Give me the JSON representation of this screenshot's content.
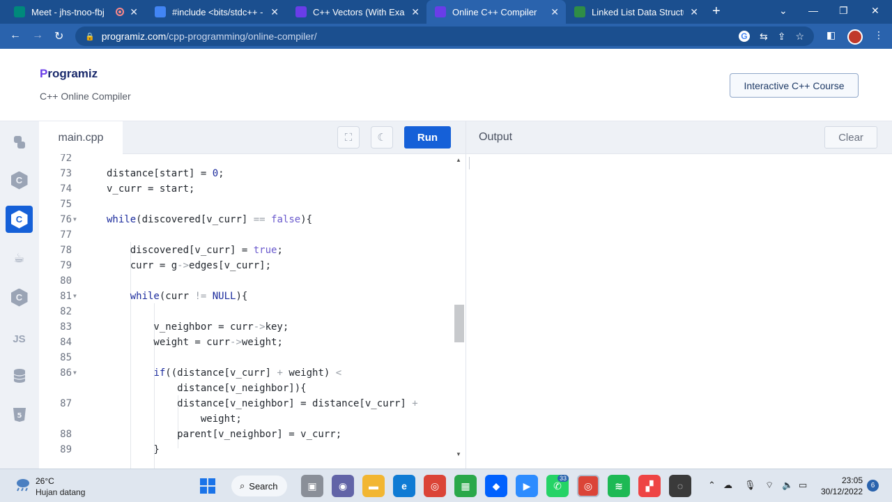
{
  "browser": {
    "tabs": [
      {
        "title": "Meet - jhs-tnoo-fbj",
        "favicon": "google-meet-icon",
        "color": "#00897b"
      },
      {
        "title": "#include <bits/stdc++ - G",
        "favicon": "google-docs-icon",
        "color": "#4285f4"
      },
      {
        "title": "C++ Vectors (With Examp",
        "favicon": "programiz-icon",
        "color": "#6a3de8"
      },
      {
        "title": "Online C++ Compiler",
        "favicon": "programiz-icon",
        "color": "#6a3de8"
      },
      {
        "title": "Linked List Data Structure",
        "favicon": "geeksforgeeks-icon",
        "color": "#2f8d46"
      }
    ],
    "new_tab": "+",
    "url_host": "programiz.com",
    "url_path": "/cpp-programming/online-compiler/"
  },
  "header": {
    "logo_p": "P",
    "logo_rest": "rogramiz",
    "subtitle": "C++ Online Compiler",
    "course_button": "Interactive C++ Course"
  },
  "rail": [
    {
      "name": "python",
      "label": ""
    },
    {
      "name": "c",
      "label": "C"
    },
    {
      "name": "cpp",
      "label": "C"
    },
    {
      "name": "java",
      "label": ""
    },
    {
      "name": "csharp",
      "label": "C"
    },
    {
      "name": "javascript",
      "label": "JS"
    },
    {
      "name": "sql",
      "label": ""
    },
    {
      "name": "html",
      "label": "5"
    }
  ],
  "editor": {
    "file_name": "main.cpp",
    "run_label": "Run",
    "lines": [
      {
        "n": "72",
        "fold": false,
        "code": ""
      },
      {
        "n": "73",
        "fold": false,
        "code": "distance[start] = 0;"
      },
      {
        "n": "74",
        "fold": false,
        "code": "v_curr = start;"
      },
      {
        "n": "75",
        "fold": false,
        "code": ""
      },
      {
        "n": "76",
        "fold": true,
        "code": "while(discovered[v_curr] == false){"
      },
      {
        "n": "77",
        "fold": false,
        "code": ""
      },
      {
        "n": "78",
        "fold": false,
        "code": "    discovered[v_curr] = true;"
      },
      {
        "n": "79",
        "fold": false,
        "code": "    curr = g->edges[v_curr];"
      },
      {
        "n": "80",
        "fold": false,
        "code": ""
      },
      {
        "n": "81",
        "fold": true,
        "code": "    while(curr != NULL){"
      },
      {
        "n": "82",
        "fold": false,
        "code": ""
      },
      {
        "n": "83",
        "fold": false,
        "code": "        v_neighbor = curr->key;"
      },
      {
        "n": "84",
        "fold": false,
        "code": "        weight = curr->weight;"
      },
      {
        "n": "85",
        "fold": false,
        "code": ""
      },
      {
        "n": "86",
        "fold": true,
        "code": "        if((distance[v_curr] + weight) <"
      },
      {
        "n": "",
        "fold": false,
        "code": "            distance[v_neighbor]){"
      },
      {
        "n": "87",
        "fold": false,
        "code": "            distance[v_neighbor] = distance[v_curr] +"
      },
      {
        "n": "",
        "fold": false,
        "code": "                weight;"
      },
      {
        "n": "88",
        "fold": false,
        "code": "            parent[v_neighbor] = v_curr;"
      },
      {
        "n": "89",
        "fold": false,
        "code": "        }"
      }
    ]
  },
  "output": {
    "title": "Output",
    "clear_label": "Clear",
    "content": ""
  },
  "taskbar": {
    "temperature": "26°C",
    "weather": "Hujan datang",
    "search_label": "Search",
    "whatsapp_badge": "33",
    "time": "23:05",
    "date": "30/12/2022",
    "notifications": "6"
  },
  "colors": {
    "browser_frame": "#1b4f8f",
    "accent": "#1560d8",
    "keyword": "#1a2a9c",
    "boolean": "#6a5acd"
  }
}
